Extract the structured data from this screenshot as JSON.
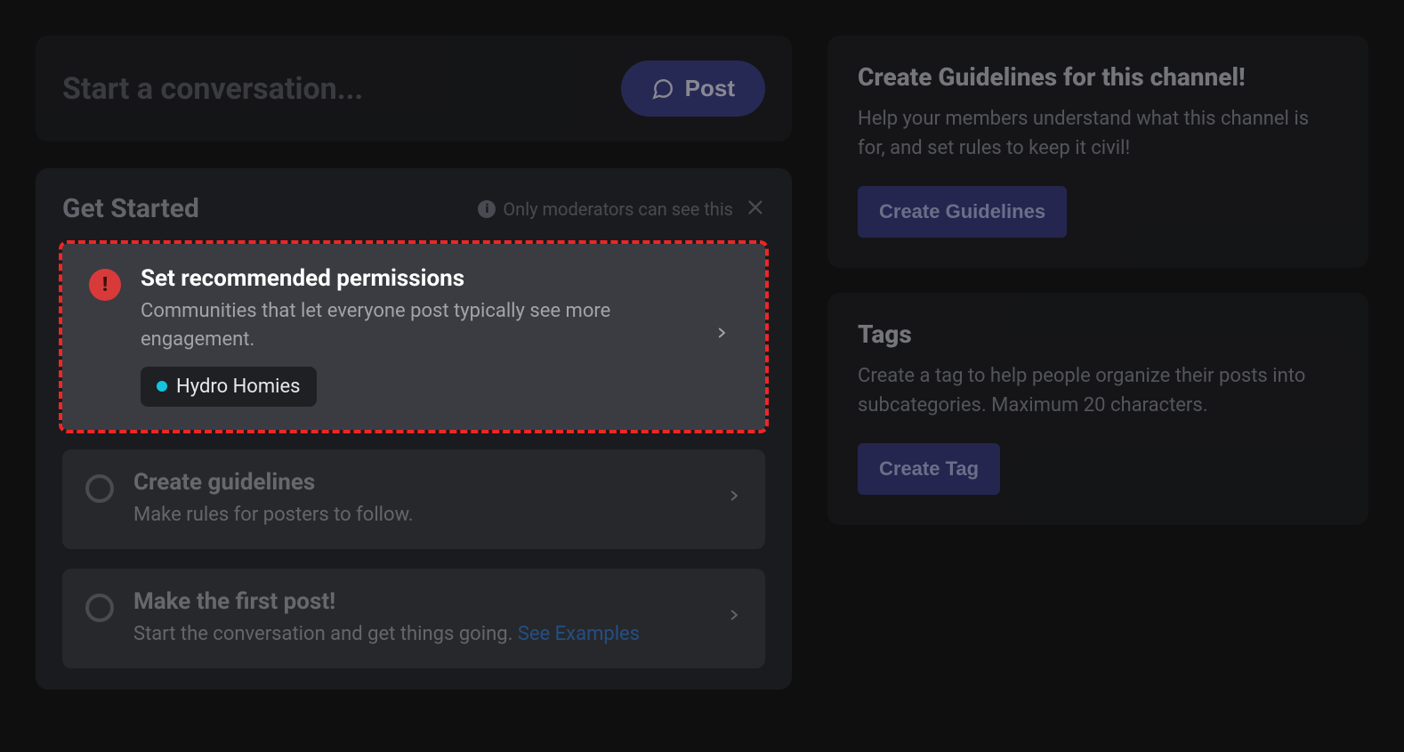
{
  "compose": {
    "placeholder": "Start a conversation...",
    "post_label": "Post"
  },
  "get_started": {
    "title": "Get Started",
    "mod_note": "Only moderators can see this",
    "tasks": [
      {
        "title": "Set recommended permissions",
        "desc": "Communities that let everyone post typically see more engagement.",
        "role_chip": "Hydro Homies"
      },
      {
        "title": "Create guidelines",
        "desc": "Make rules for posters to follow."
      },
      {
        "title": "Make the first post!",
        "desc_pre": "Start the conversation and get things going. ",
        "desc_link": "See Examples"
      }
    ]
  },
  "guidelines_panel": {
    "title": "Create Guidelines for this channel!",
    "desc": "Help your members understand what this channel is for, and set rules to keep it civil!",
    "button": "Create Guidelines"
  },
  "tags_panel": {
    "title": "Tags",
    "desc": "Create a tag to help people organize their posts into subcategories. Maximum 20 characters.",
    "button": "Create Tag"
  }
}
